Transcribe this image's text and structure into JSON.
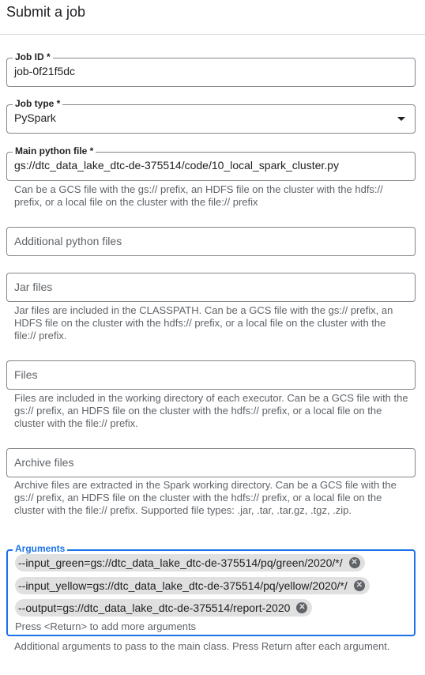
{
  "header": {
    "title": "Submit a job"
  },
  "job_id": {
    "label": "Job ID *",
    "value": "job-0f21f5dc"
  },
  "job_type": {
    "label": "Job type *",
    "value": "PySpark",
    "icon": "chevron-down-icon"
  },
  "main_python_file": {
    "label": "Main python file *",
    "value": "gs://dtc_data_lake_dtc-de-375514/code/10_local_spark_cluster.py",
    "hint": "Can be a GCS file with the gs:// prefix, an HDFS file on the cluster with the hdfs:// prefix, or a local file on the cluster with the file:// prefix"
  },
  "additional_python_files": {
    "placeholder": "Additional python files"
  },
  "jar_files": {
    "placeholder": "Jar files",
    "hint": "Jar files are included in the CLASSPATH. Can be a GCS file with the gs:// prefix, an HDFS file on the cluster with the hdfs:// prefix, or a local file on the cluster with the file:// prefix."
  },
  "files": {
    "placeholder": "Files",
    "hint": "Files are included in the working directory of each executor. Can be a GCS file with the gs:// prefix, an HDFS file on the cluster with the hdfs:// prefix, or a local file on the cluster with the file:// prefix."
  },
  "archive_files": {
    "placeholder": "Archive files",
    "hint": "Archive files are extracted in the Spark working directory. Can be a GCS file with the gs:// prefix, an HDFS file on the cluster with the hdfs:// prefix, or a local file on the cluster with the file:// prefix. Supported file types: .jar, .tar, .tar.gz, .tgz, .zip."
  },
  "arguments": {
    "label": "Arguments",
    "chips": [
      "--input_green=gs://dtc_data_lake_dtc-de-375514/pq/green/2020/*/",
      "--input_yellow=gs://dtc_data_lake_dtc-de-375514/pq/yellow/2020/*/",
      "--output=gs://dtc_data_lake_dtc-de-375514/report-2020"
    ],
    "chip_close_glyph": "✕",
    "input_placeholder": "Press <Return> to add more arguments",
    "hint": "Additional arguments to pass to the main class. Press Return after each argument."
  }
}
